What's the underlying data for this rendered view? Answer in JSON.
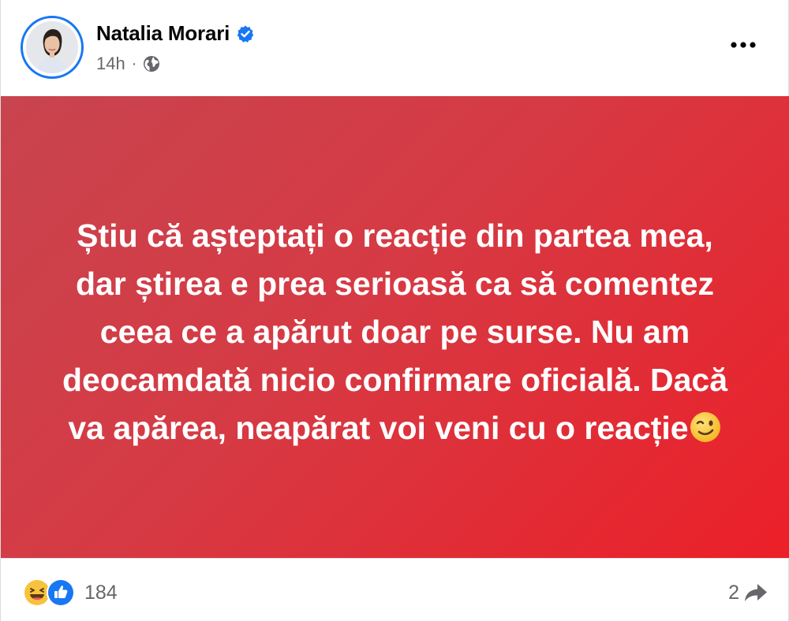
{
  "post": {
    "author": {
      "name": "Natalia Morari",
      "verified": true,
      "avatar_icon": "profile-photo-icon"
    },
    "meta": {
      "time": "14h",
      "separator": "·",
      "audience_icon": "globe-icon"
    },
    "more_icon": "more-options-icon",
    "body": {
      "background_colors": [
        "#c8444e",
        "#ec1f28"
      ],
      "text_color": "#ffffff",
      "text": "Știu că așteptați o reacție din partea mea, dar știrea e prea serioasă ca să comentez ceea ce a apărut doar pe surse. Nu am deocamdată nicio confirmare oficială. Dacă va apărea, neapărat voi veni cu o reacție",
      "trailing_emoji": "winking-face-icon"
    },
    "footer": {
      "reaction_icons": [
        "haha-reaction-icon",
        "like-reaction-icon"
      ],
      "reaction_count": "184",
      "share_count": "2",
      "share_icon": "share-arrow-icon"
    },
    "colors": {
      "accent": "#1877f2",
      "secondary_text": "#65676b"
    }
  }
}
